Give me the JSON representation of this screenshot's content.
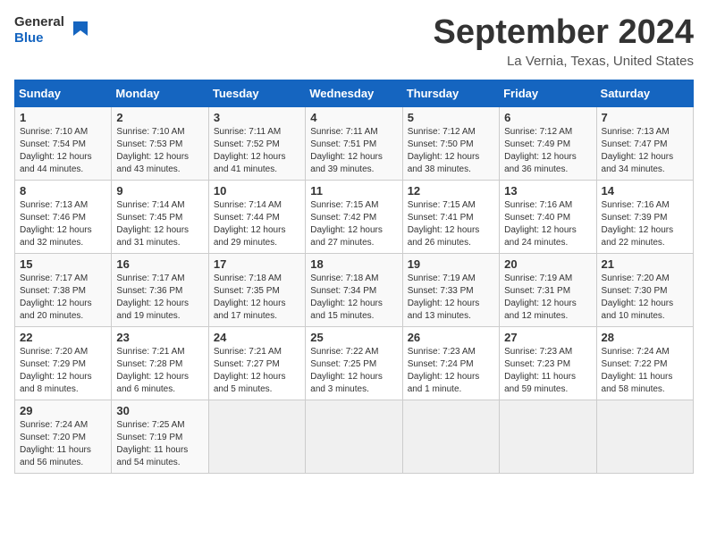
{
  "header": {
    "logo_general": "General",
    "logo_blue": "Blue",
    "title": "September 2024",
    "location": "La Vernia, Texas, United States"
  },
  "weekdays": [
    "Sunday",
    "Monday",
    "Tuesday",
    "Wednesday",
    "Thursday",
    "Friday",
    "Saturday"
  ],
  "weeks": [
    [
      {
        "day": "1",
        "info": "Sunrise: 7:10 AM\nSunset: 7:54 PM\nDaylight: 12 hours\nand 44 minutes."
      },
      {
        "day": "2",
        "info": "Sunrise: 7:10 AM\nSunset: 7:53 PM\nDaylight: 12 hours\nand 43 minutes."
      },
      {
        "day": "3",
        "info": "Sunrise: 7:11 AM\nSunset: 7:52 PM\nDaylight: 12 hours\nand 41 minutes."
      },
      {
        "day": "4",
        "info": "Sunrise: 7:11 AM\nSunset: 7:51 PM\nDaylight: 12 hours\nand 39 minutes."
      },
      {
        "day": "5",
        "info": "Sunrise: 7:12 AM\nSunset: 7:50 PM\nDaylight: 12 hours\nand 38 minutes."
      },
      {
        "day": "6",
        "info": "Sunrise: 7:12 AM\nSunset: 7:49 PM\nDaylight: 12 hours\nand 36 minutes."
      },
      {
        "day": "7",
        "info": "Sunrise: 7:13 AM\nSunset: 7:47 PM\nDaylight: 12 hours\nand 34 minutes."
      }
    ],
    [
      {
        "day": "8",
        "info": "Sunrise: 7:13 AM\nSunset: 7:46 PM\nDaylight: 12 hours\nand 32 minutes."
      },
      {
        "day": "9",
        "info": "Sunrise: 7:14 AM\nSunset: 7:45 PM\nDaylight: 12 hours\nand 31 minutes."
      },
      {
        "day": "10",
        "info": "Sunrise: 7:14 AM\nSunset: 7:44 PM\nDaylight: 12 hours\nand 29 minutes."
      },
      {
        "day": "11",
        "info": "Sunrise: 7:15 AM\nSunset: 7:42 PM\nDaylight: 12 hours\nand 27 minutes."
      },
      {
        "day": "12",
        "info": "Sunrise: 7:15 AM\nSunset: 7:41 PM\nDaylight: 12 hours\nand 26 minutes."
      },
      {
        "day": "13",
        "info": "Sunrise: 7:16 AM\nSunset: 7:40 PM\nDaylight: 12 hours\nand 24 minutes."
      },
      {
        "day": "14",
        "info": "Sunrise: 7:16 AM\nSunset: 7:39 PM\nDaylight: 12 hours\nand 22 minutes."
      }
    ],
    [
      {
        "day": "15",
        "info": "Sunrise: 7:17 AM\nSunset: 7:38 PM\nDaylight: 12 hours\nand 20 minutes."
      },
      {
        "day": "16",
        "info": "Sunrise: 7:17 AM\nSunset: 7:36 PM\nDaylight: 12 hours\nand 19 minutes."
      },
      {
        "day": "17",
        "info": "Sunrise: 7:18 AM\nSunset: 7:35 PM\nDaylight: 12 hours\nand 17 minutes."
      },
      {
        "day": "18",
        "info": "Sunrise: 7:18 AM\nSunset: 7:34 PM\nDaylight: 12 hours\nand 15 minutes."
      },
      {
        "day": "19",
        "info": "Sunrise: 7:19 AM\nSunset: 7:33 PM\nDaylight: 12 hours\nand 13 minutes."
      },
      {
        "day": "20",
        "info": "Sunrise: 7:19 AM\nSunset: 7:31 PM\nDaylight: 12 hours\nand 12 minutes."
      },
      {
        "day": "21",
        "info": "Sunrise: 7:20 AM\nSunset: 7:30 PM\nDaylight: 12 hours\nand 10 minutes."
      }
    ],
    [
      {
        "day": "22",
        "info": "Sunrise: 7:20 AM\nSunset: 7:29 PM\nDaylight: 12 hours\nand 8 minutes."
      },
      {
        "day": "23",
        "info": "Sunrise: 7:21 AM\nSunset: 7:28 PM\nDaylight: 12 hours\nand 6 minutes."
      },
      {
        "day": "24",
        "info": "Sunrise: 7:21 AM\nSunset: 7:27 PM\nDaylight: 12 hours\nand 5 minutes."
      },
      {
        "day": "25",
        "info": "Sunrise: 7:22 AM\nSunset: 7:25 PM\nDaylight: 12 hours\nand 3 minutes."
      },
      {
        "day": "26",
        "info": "Sunrise: 7:23 AM\nSunset: 7:24 PM\nDaylight: 12 hours\nand 1 minute."
      },
      {
        "day": "27",
        "info": "Sunrise: 7:23 AM\nSunset: 7:23 PM\nDaylight: 11 hours\nand 59 minutes."
      },
      {
        "day": "28",
        "info": "Sunrise: 7:24 AM\nSunset: 7:22 PM\nDaylight: 11 hours\nand 58 minutes."
      }
    ],
    [
      {
        "day": "29",
        "info": "Sunrise: 7:24 AM\nSunset: 7:20 PM\nDaylight: 11 hours\nand 56 minutes."
      },
      {
        "day": "30",
        "info": "Sunrise: 7:25 AM\nSunset: 7:19 PM\nDaylight: 11 hours\nand 54 minutes."
      },
      {
        "day": "",
        "info": ""
      },
      {
        "day": "",
        "info": ""
      },
      {
        "day": "",
        "info": ""
      },
      {
        "day": "",
        "info": ""
      },
      {
        "day": "",
        "info": ""
      }
    ]
  ]
}
